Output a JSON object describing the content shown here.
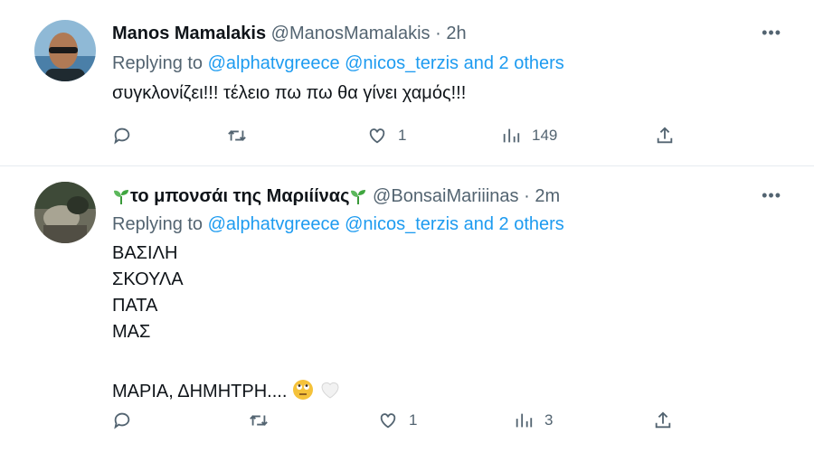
{
  "tweets": [
    {
      "display_name": "Manos Mamalakis",
      "handle": "@ManosMamalakis",
      "time": "2h",
      "reply_prefix": "Replying to",
      "reply_mentions": "@alphatvgreece @nicos_terzis and 2 others",
      "text_lines": [
        "συγκλονίζει!!! τέλειο πω πω θα γίνει χαμός!!!"
      ],
      "counts": {
        "reply": "",
        "retweet": "",
        "like": "1",
        "views": "149"
      }
    },
    {
      "display_name": "το μπονσάι της Μαριίίνας",
      "handle": "@BonsaiMariiinas",
      "time": "2m",
      "reply_prefix": "Replying to",
      "reply_mentions": "@alphatvgreece @nicos_terzis and 2 others",
      "text_lines": [
        "ΒΑΣΙΛΗ",
        "ΣΚΟΥΛΑ",
        "ΠΑΤΑ",
        "ΜΑΣ",
        "",
        "ΜΑΡΙΑ, ΔΗΜΗΤΡΗ...."
      ],
      "counts": {
        "reply": "",
        "retweet": "",
        "like": "1",
        "views": "3"
      }
    }
  ],
  "icons": {
    "more": "more-horizontal-icon",
    "reply": "reply-icon",
    "retweet": "retweet-icon",
    "like": "heart-icon",
    "views": "views-icon",
    "share": "share-icon",
    "name_emoji": "seedling-icon",
    "text_emoji_1": "rolling-eyes-emoji",
    "text_emoji_2": "white-heart-emoji"
  },
  "colors": {
    "link": "#1d9bf0",
    "secondary_text": "#536471",
    "primary_text": "#0f1419",
    "divider": "#e6ecf0"
  }
}
